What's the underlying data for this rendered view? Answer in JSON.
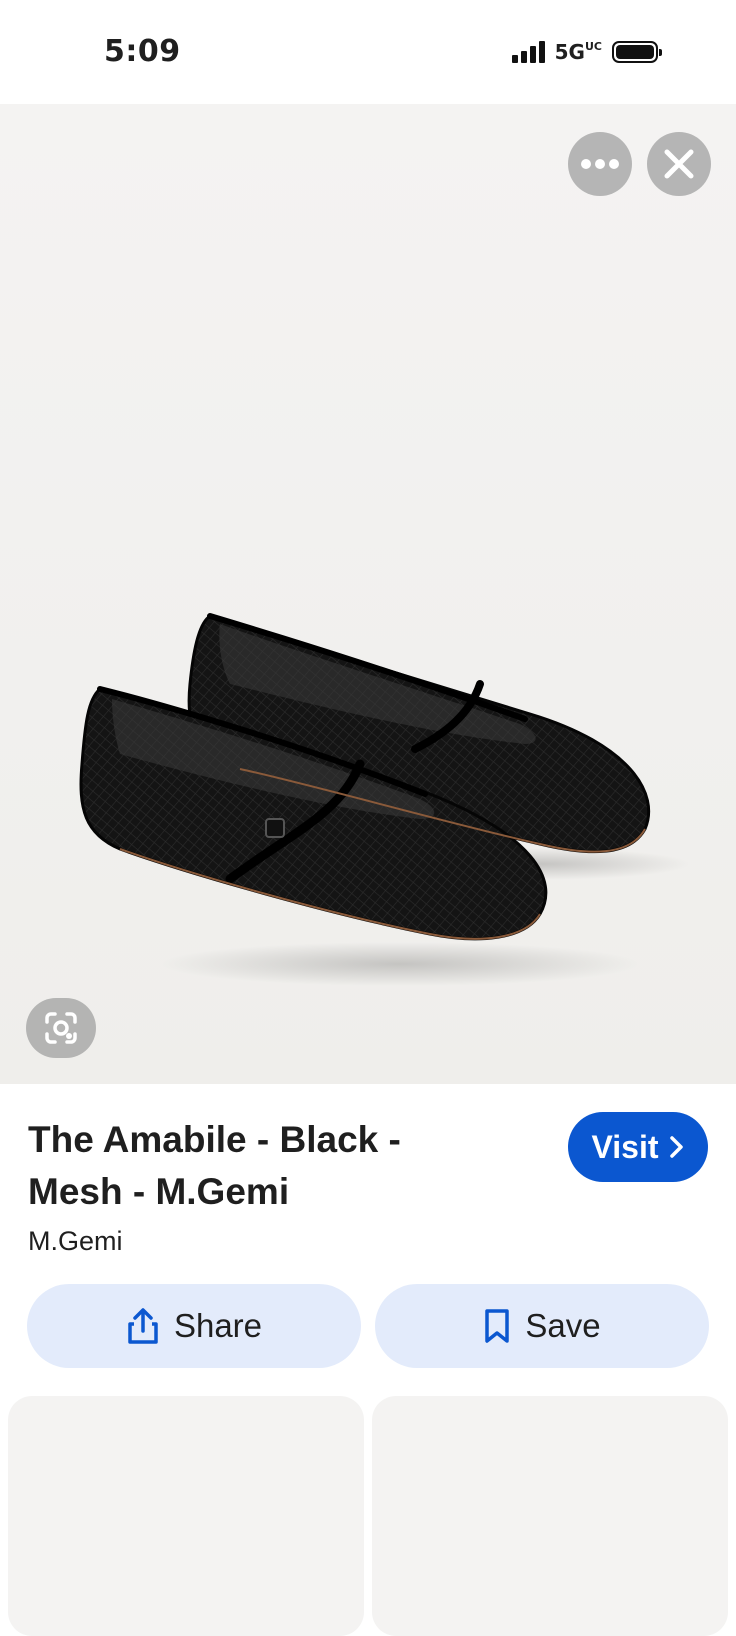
{
  "status_bar": {
    "time": "5:09",
    "network": "5G",
    "network_badge": "UC"
  },
  "colors": {
    "visit_button": "#0b57d0",
    "action_pill_bg": "#e3ebfb",
    "action_icon": "#0b57d0"
  },
  "image_viewer": {
    "more_icon": "more-horiz-icon",
    "close_icon": "close-icon",
    "lens_icon": "google-lens-icon"
  },
  "result": {
    "title": "The Amabile - Black - Mesh - M.Gemi",
    "source": "M.Gemi",
    "visit_label": "Visit"
  },
  "actions": {
    "share_label": "Share",
    "save_label": "Save"
  }
}
